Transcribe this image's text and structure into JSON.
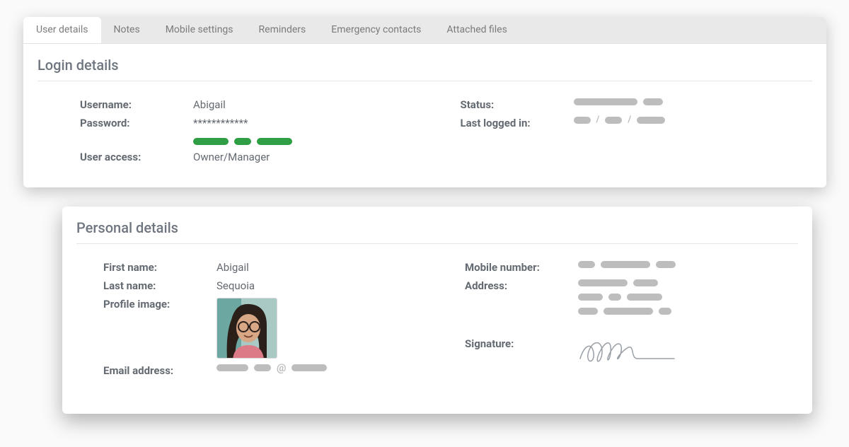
{
  "tabs": [
    {
      "label": "User details",
      "active": true
    },
    {
      "label": "Notes"
    },
    {
      "label": "Mobile settings"
    },
    {
      "label": "Reminders"
    },
    {
      "label": "Emergency contacts"
    },
    {
      "label": "Attached files"
    }
  ],
  "login": {
    "section_title": "Login details",
    "username_label": "Username:",
    "username_value": "Abigail",
    "password_label": "Password:",
    "password_value": "************",
    "user_access_label": "User access:",
    "user_access_value": "Owner/Manager",
    "status_label": "Status:",
    "last_logged_in_label": "Last logged in:"
  },
  "personal": {
    "section_title": "Personal details",
    "first_name_label": "First name:",
    "first_name_value": "Abigail",
    "last_name_label": "Last name:",
    "last_name_value": "Sequoia",
    "profile_image_label": "Profile image:",
    "email_label": "Email address:",
    "mobile_label": "Mobile number:",
    "address_label": "Address:",
    "signature_label": "Signature:"
  }
}
